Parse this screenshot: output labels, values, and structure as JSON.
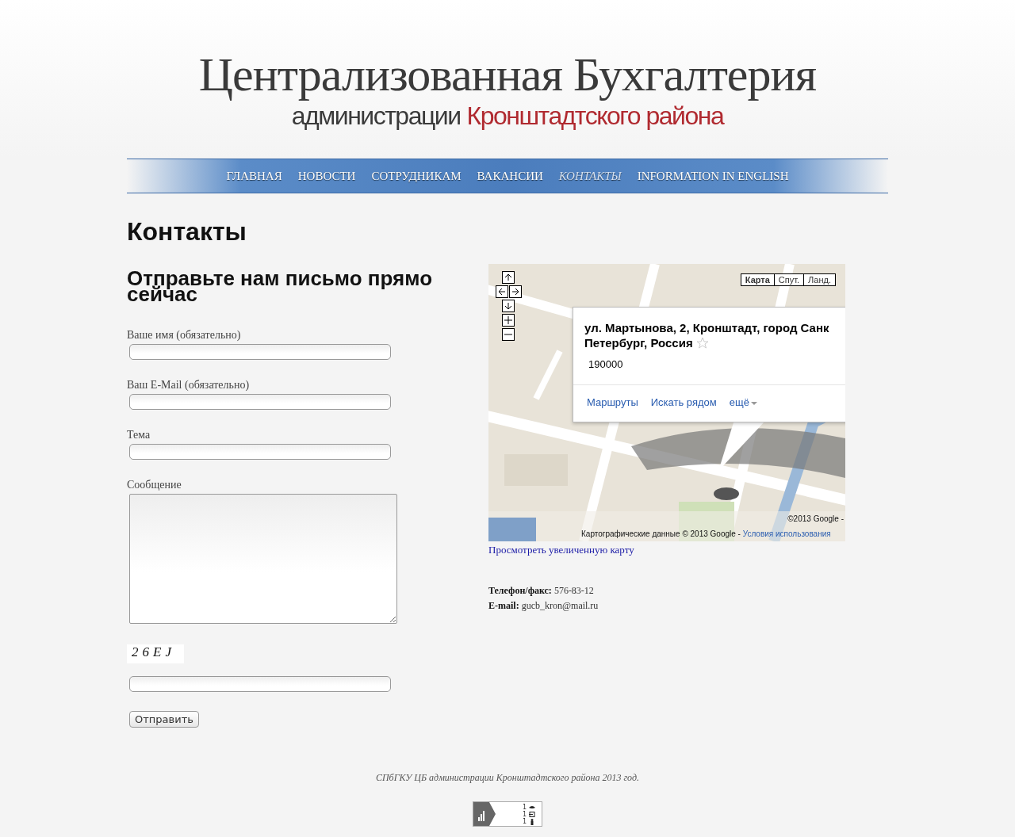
{
  "header": {
    "title": "Централизованная Бухгалтерия",
    "subtitle_plain": "администрации",
    "subtitle_accent": "Кронштадтского района"
  },
  "nav": [
    {
      "label": "ГЛАВНАЯ",
      "selected": false
    },
    {
      "label": "НОВОСТИ",
      "selected": false
    },
    {
      "label": "СОТРУДНИКАМ",
      "selected": false
    },
    {
      "label": "ВАКАНСИИ",
      "selected": false
    },
    {
      "label": "КОНТАКТЫ",
      "selected": true
    },
    {
      "label": "INFORMATION IN ENGLISH",
      "selected": false
    }
  ],
  "page_title": "Контакты",
  "form": {
    "heading": "Отправьте нам письмо прямо сейчас",
    "fields": [
      {
        "label": "Ваше имя (обязательно)",
        "kind": "line"
      },
      {
        "label": "Ваш E-Mail (обязательно)",
        "kind": "line"
      },
      {
        "label": "Тема",
        "kind": "line"
      },
      {
        "label": "Сообщение",
        "kind": "area"
      }
    ],
    "captcha": "26EJ",
    "submit": "Отправить"
  },
  "map": {
    "kind": "picture",
    "map_types": [
      {
        "label": "Карта",
        "selected": true
      },
      {
        "label": "Спут.",
        "selected": false
      },
      {
        "label": "Ланд.",
        "selected": false
      }
    ],
    "info": {
      "address_lines": [
        "ул. Мартынова, 2, Кронштадт, город Санк",
        "Петербург, Россия"
      ],
      "postcode": "190000",
      "links": [
        "Маршруты",
        "Искать рядом",
        "ещё"
      ]
    },
    "copyright": "©2013 Google -",
    "map_data": "Картографические данные © 2013 Google -",
    "terms": "Условия использования",
    "larger_link": "Просмотреть увеличенную карту"
  },
  "contacts": [
    {
      "label": "Телефон/факс:",
      "value": "576-83-12"
    },
    {
      "label": "E-mail:",
      "value": "gucb_kron@mail.ru"
    }
  ],
  "footer": "СПбГКУ ЦБ администрации Кронштадтского района 2013 год.",
  "counter": [
    "1",
    "1",
    "1"
  ]
}
